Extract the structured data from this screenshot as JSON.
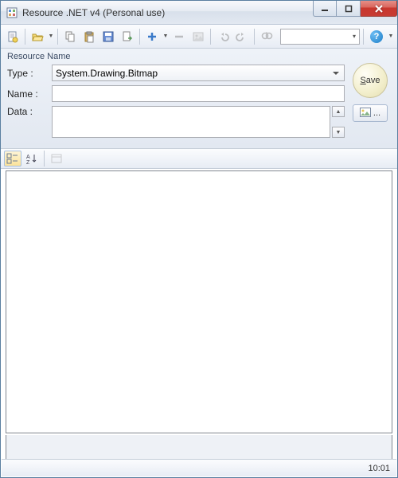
{
  "window": {
    "title": "Resource .NET v4 (Personal use)"
  },
  "toolbar": {
    "combo_value": ""
  },
  "form": {
    "header": "Resource Name",
    "type_label": "Type :",
    "type_value": "System.Drawing.Bitmap",
    "name_label": "Name :",
    "name_value": "",
    "data_label": "Data :",
    "data_value": "",
    "save_label": "ave",
    "save_accel": "S",
    "browse_label": "..."
  },
  "status": {
    "time": "10:01"
  },
  "icons": {
    "new": "new-resource-icon",
    "open": "open-folder-icon",
    "copy": "copy-icon",
    "paste": "paste-icon",
    "save": "save-icon",
    "saveas": "save-as-icon",
    "add": "plus-icon",
    "remove": "minus-icon",
    "image": "image-icon",
    "undo": "undo-icon",
    "redo": "redo-icon",
    "find": "find-icon",
    "help": "help-icon"
  }
}
